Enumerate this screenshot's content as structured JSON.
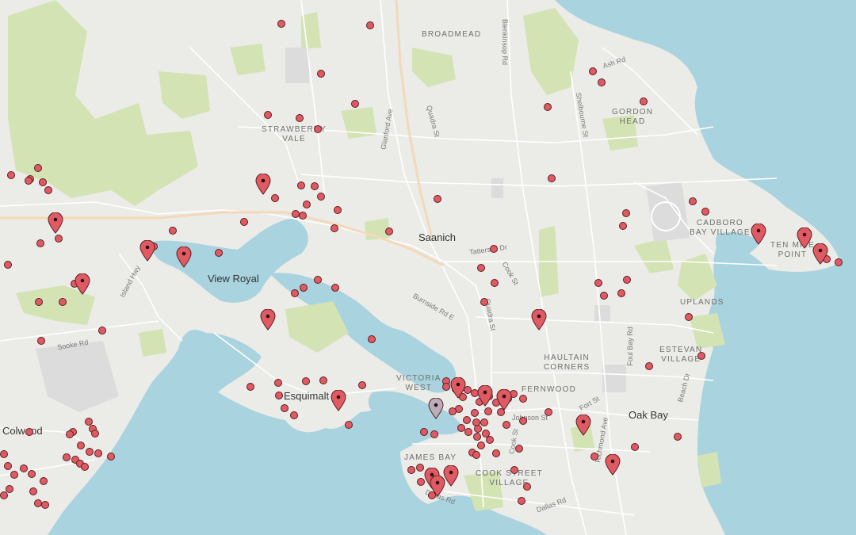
{
  "map": {
    "colors": {
      "water": "#a9d3df",
      "land": "#ebebe8",
      "park": "#d3e3b3",
      "road": "#ffffff",
      "highway": "#f3d9b8",
      "marker": "#e05a63",
      "marker_selected": "#b9aeb9"
    },
    "places": [
      {
        "name": "broadmead",
        "text": "BROADMEAD",
        "kind": "lbl"
      },
      {
        "name": "strawberry-vale",
        "text": "STRAWBERRY\nVALE",
        "kind": "lbl"
      },
      {
        "name": "gordon-head",
        "text": "GORDON\nHEAD",
        "kind": "lbl"
      },
      {
        "name": "cadboro-bay-village",
        "text": "CADBORO\nBAY VILLAGE",
        "kind": "lbl"
      },
      {
        "name": "ten-mile-point",
        "text": "TEN MILE\nPOINT",
        "kind": "lbl"
      },
      {
        "name": "uplands",
        "text": "UPLANDS",
        "kind": "lbl"
      },
      {
        "name": "estevan-village",
        "text": "ESTEVAN\nVILLAGE",
        "kind": "lbl"
      },
      {
        "name": "haultain-corners",
        "text": "HAULTAIN\nCORNERS",
        "kind": "lbl"
      },
      {
        "name": "fernwood",
        "text": "FERNWOOD",
        "kind": "lbl"
      },
      {
        "name": "victoria-west",
        "text": "VICTORIA\nWEST",
        "kind": "lbl"
      },
      {
        "name": "james-bay",
        "text": "JAMES BAY",
        "kind": "lbl"
      },
      {
        "name": "cook-street-village",
        "text": "COOK STREET\nVILLAGE",
        "kind": "lbl"
      },
      {
        "name": "saanich",
        "text": "Saanich",
        "kind": "city"
      },
      {
        "name": "view-royal",
        "text": "View Royal",
        "kind": "city"
      },
      {
        "name": "esquimalt",
        "text": "Esquimalt",
        "kind": "city"
      },
      {
        "name": "oak-bay",
        "text": "Oak Bay",
        "kind": "city"
      },
      {
        "name": "colwood",
        "text": "Colwood",
        "kind": "city"
      }
    ],
    "roads": [
      {
        "name": "blenkinsop-rd",
        "text": "Blenkinsop Rd"
      },
      {
        "name": "ash-rd",
        "text": "Ash Rd"
      },
      {
        "name": "shelbourne-st",
        "text": "Shelbourne St"
      },
      {
        "name": "glanford-ave",
        "text": "Glanford Ave"
      },
      {
        "name": "quadra-st-north",
        "text": "Quadra St"
      },
      {
        "name": "tattersall-dr",
        "text": "Tattersall Dr"
      },
      {
        "name": "cook-st-north",
        "text": "Cook St"
      },
      {
        "name": "quadra-st-south",
        "text": "Quadra St"
      },
      {
        "name": "burnside-rd-e",
        "text": "Burnside Rd E"
      },
      {
        "name": "island-hwy",
        "text": "Island Hwy"
      },
      {
        "name": "sooke-rd",
        "text": "Sooke Rd"
      },
      {
        "name": "foul-bay-rd",
        "text": "Foul Bay Rd"
      },
      {
        "name": "beach-dr",
        "text": "Beach Dr"
      },
      {
        "name": "fort-st",
        "text": "Fort St"
      },
      {
        "name": "johnson-st",
        "text": "Johnson St"
      },
      {
        "name": "cook-st-south",
        "text": "Cook St"
      },
      {
        "name": "richmond-ave",
        "text": "Richmond Ave"
      },
      {
        "name": "dallas-rd",
        "text": "Dallas Rd"
      },
      {
        "name": "douglas-rd",
        "text": "Dallas Rd"
      }
    ]
  }
}
